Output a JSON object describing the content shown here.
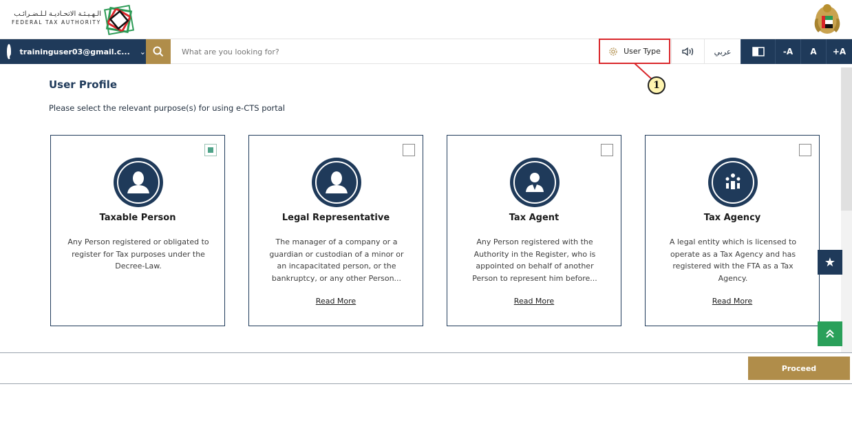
{
  "header": {
    "logo_ar": "الـهـيـئـة الاتحـاديـة لـلـضـرائـب",
    "logo_en": "FEDERAL TAX AUTHORITY"
  },
  "toolbar": {
    "user_email": "traininguser03@gmail.c...",
    "search_placeholder": "What are you looking for?",
    "user_type_label": "User Type",
    "arabic_label": "عربي",
    "decrease_font": "-A",
    "normal_font": "A",
    "increase_font": "+A"
  },
  "annotation": {
    "callout_number": "1"
  },
  "main": {
    "title": "User Profile",
    "subtitle": "Please select the relevant purpose(s) for using e-CTS portal",
    "cards": [
      {
        "title": "Taxable Person",
        "description": "Any Person registered or obligated to register for Tax purposes under the Decree-Law.",
        "checked": true,
        "read_more": ""
      },
      {
        "title": "Legal Representative",
        "description": "The manager of a company or a guardian or custodian of a minor or an incapacitated person, or the bankruptcy, or any other Person...",
        "checked": false,
        "read_more": "Read More"
      },
      {
        "title": "Tax Agent",
        "description": "Any Person registered with the Authority in the Register, who is appointed on behalf of another Person to represent him before...",
        "checked": false,
        "read_more": "Read More"
      },
      {
        "title": "Tax Agency",
        "description": "A legal entity which is licensed to operate as a Tax Agency and has registered with the FTA as a Tax Agency.",
        "checked": false,
        "read_more": "Read More"
      }
    ]
  },
  "footer": {
    "proceed_label": "Proceed"
  },
  "colors": {
    "navy": "#1f3a5a",
    "gold": "#b08d4a",
    "green": "#2aa05a",
    "highlight_red": "#d9262a"
  }
}
